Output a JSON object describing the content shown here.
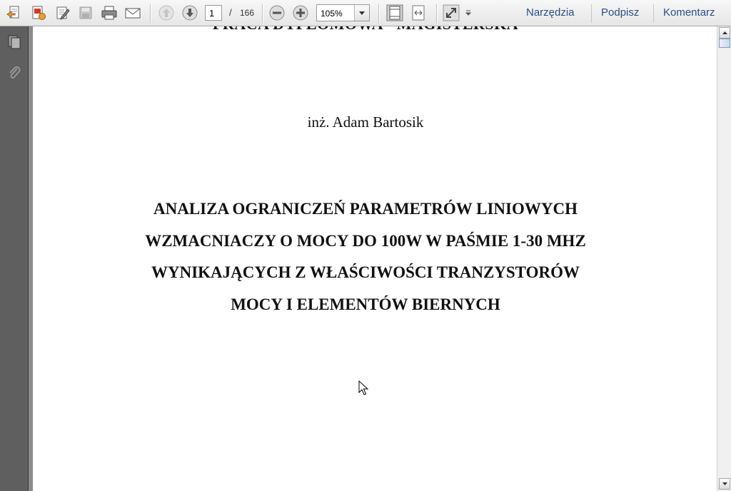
{
  "toolbar": {
    "page_current": "1",
    "page_separator": "/",
    "page_total": "166",
    "zoom": "105%",
    "menu": [
      "Narzędzia",
      "Podpisz",
      "Komentarz"
    ]
  },
  "document": {
    "header_cut": "PRACA DYPLOMOWA - MAGISTERSKA",
    "author": "inż. Adam Bartosik",
    "title_lines": [
      "ANALIZA OGRANICZEŃ PARAMETRÓW LINIOWYCH",
      "WZMACNIACZY O MOCY DO 100W W PAŚMIE 1-30 MHZ",
      "WYNIKAJĄCYCH Z WŁAŚCIWOŚCI TRANZYSTORÓW",
      "MOCY I ELEMENTÓW BIERNYCH"
    ]
  },
  "colors": {
    "menu_link": "#2a4e86",
    "nav_panel": "#5f5f5f",
    "icon_red": "#d23a2a",
    "icon_orange": "#e8a030"
  }
}
